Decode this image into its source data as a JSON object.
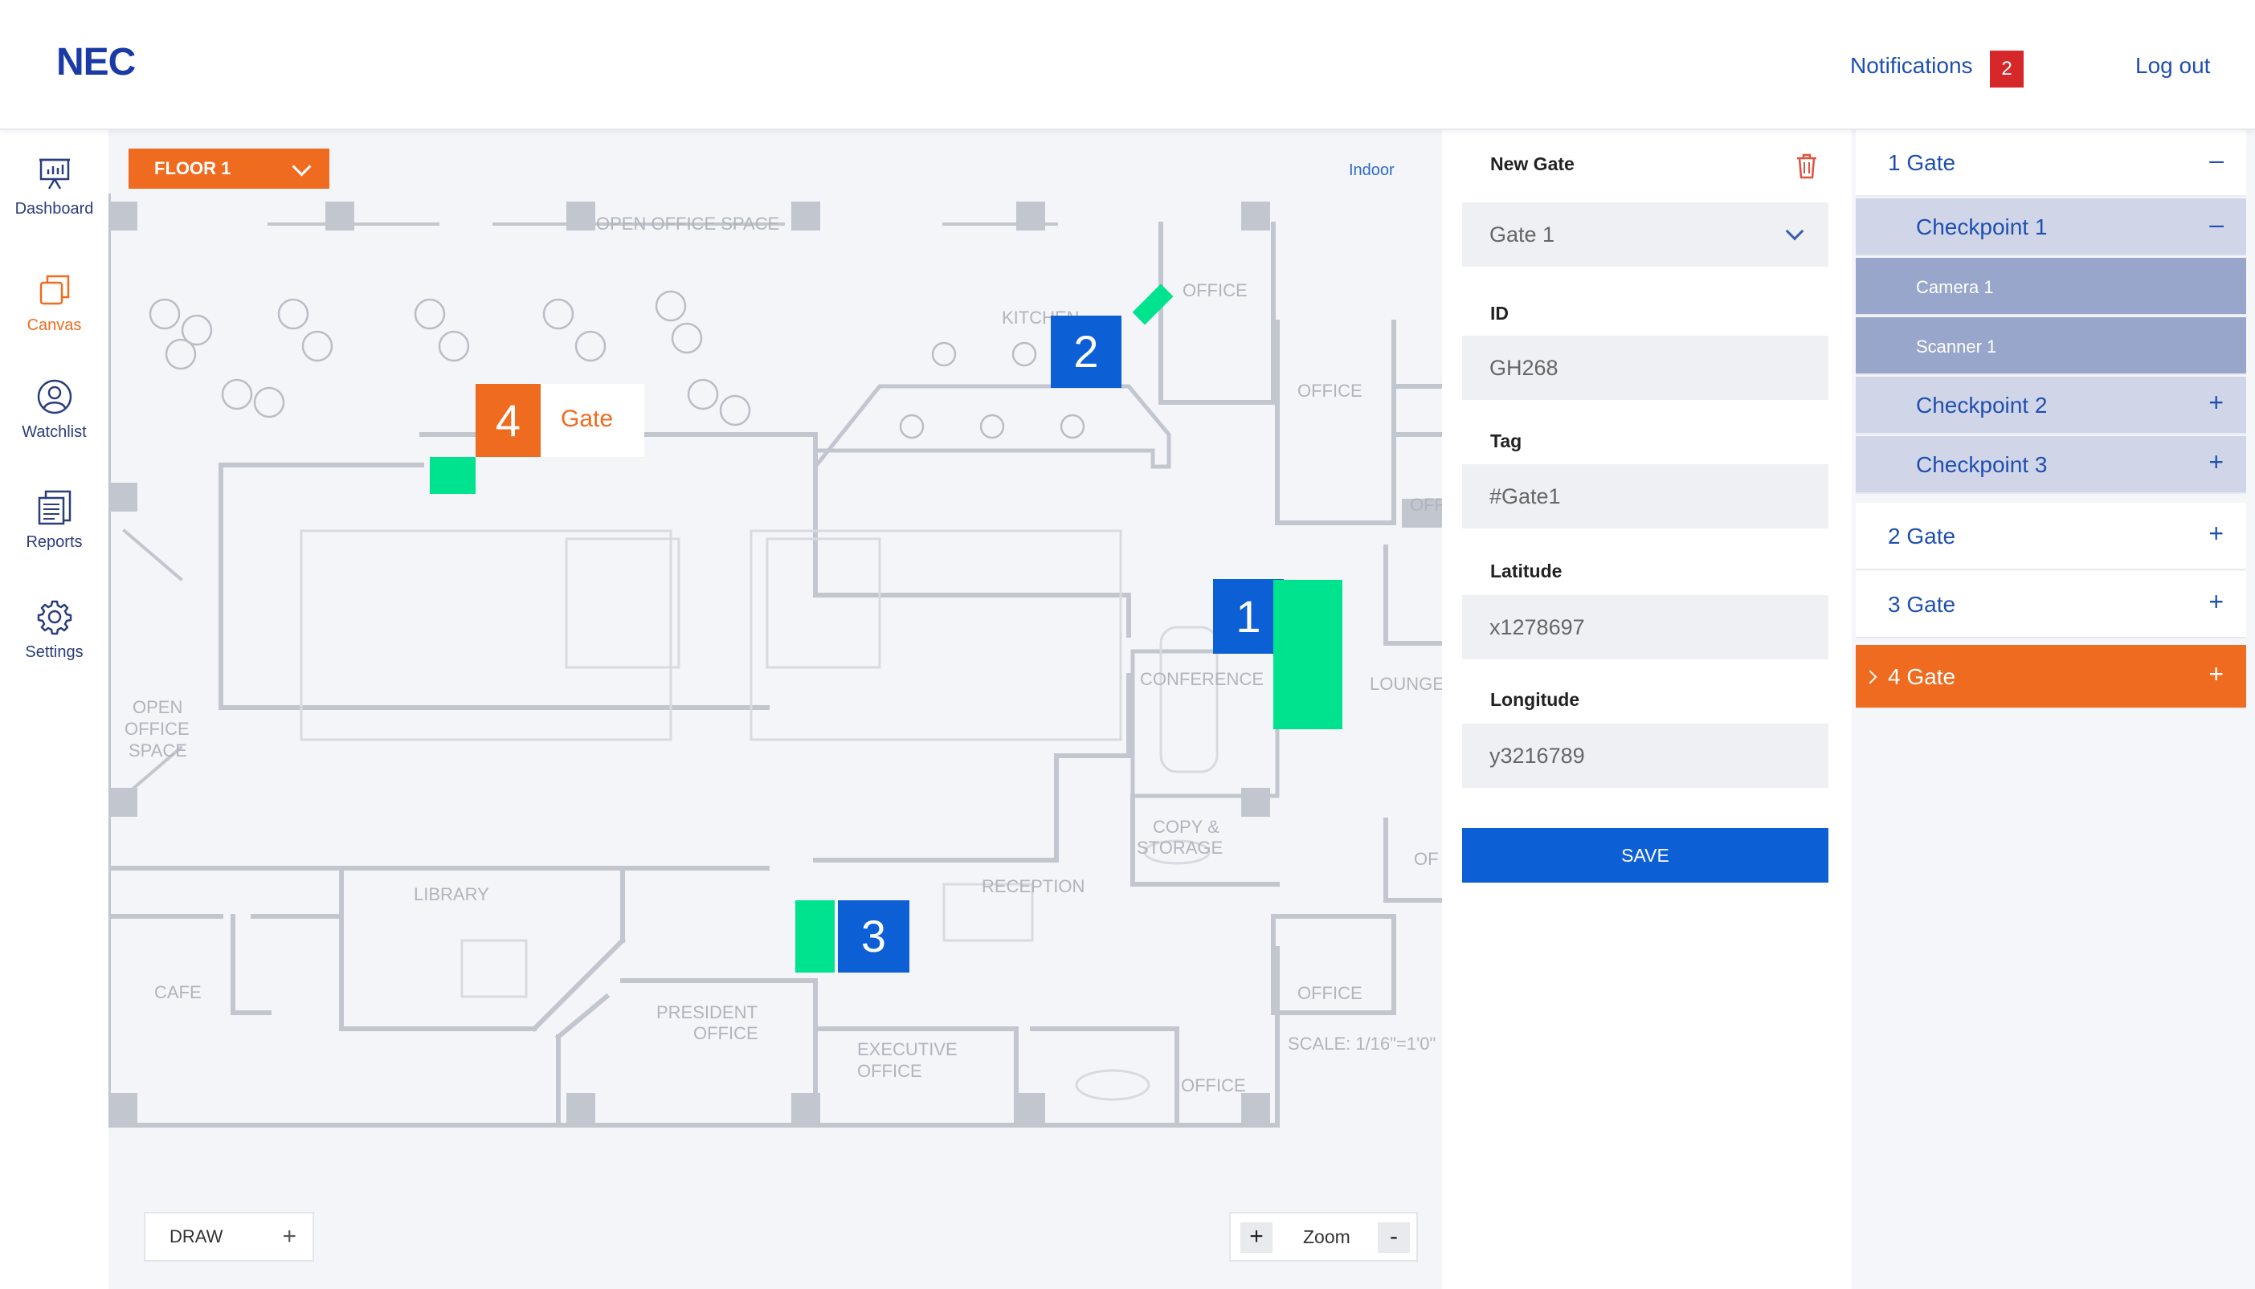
{
  "header": {
    "logo": "NEC",
    "notifications_label": "Notifications",
    "notifications_count": "2",
    "logout_label": "Log out"
  },
  "nav": {
    "items": [
      {
        "label": "Dashboard",
        "icon": "presentation-icon"
      },
      {
        "label": "Canvas",
        "icon": "canvas-icon",
        "active": true
      },
      {
        "label": "Watchlist",
        "icon": "user-icon"
      },
      {
        "label": "Reports",
        "icon": "reports-icon"
      },
      {
        "label": "Settings",
        "icon": "gear-icon"
      }
    ]
  },
  "map": {
    "floor_label": "FLOOR 1",
    "mode_label": "Indoor",
    "draw_label": "DRAW",
    "zoom_label": "Zoom",
    "zoom_in": "+",
    "zoom_out": "-",
    "rooms": {
      "open_office_space_top": "OPEN OFFICE SPACE",
      "kitchen": "KITCHEN",
      "office_a": "OFFICE",
      "office_b": "OFFICE",
      "office_c": "OFFI",
      "conference": "CONFERENCE",
      "lounge": "LOUNGE",
      "copy_storage_1": "COPY &",
      "copy_storage_2": "STORAGE",
      "open_office_left_1": "OPEN",
      "open_office_left_2": "OFFICE",
      "open_office_left_3": "SPACE",
      "library": "LIBRARY",
      "reception": "RECEPTION",
      "cafe": "CAFE",
      "president_office_1": "PRESIDENT",
      "president_office_2": "OFFICE",
      "executive_office_1": "EXECUTIVE",
      "executive_office_2": "OFFICE",
      "office_d": "OFFICE",
      "office_e": "OFFICE",
      "office_f": "OF",
      "scale": "SCALE: 1/16\"=1'0\""
    },
    "markers": [
      {
        "number": "1"
      },
      {
        "number": "2"
      },
      {
        "number": "3"
      },
      {
        "number": "4",
        "label": "Gate"
      }
    ],
    "colors": {
      "marker_blue": "#0d5fd6",
      "marker_orange": "#ef6b1f",
      "gate_green": "#00e38e"
    }
  },
  "form": {
    "title": "New Gate",
    "gate_select": "Gate 1",
    "id_label": "ID",
    "id_value": "GH268",
    "tag_label": "Tag",
    "tag_value": "#Gate1",
    "lat_label": "Latitude",
    "lat_value": "x1278697",
    "lon_label": "Longitude",
    "lon_value": "y3216789",
    "save_label": "SAVE"
  },
  "tree": {
    "gate1": "1 Gate",
    "cp1": "Checkpoint 1",
    "camera1": "Camera 1",
    "scanner1": "Scanner 1",
    "cp2": "Checkpoint 2",
    "cp3": "Checkpoint 3",
    "gate2": "2 Gate",
    "gate3": "3 Gate",
    "gate4": "4 Gate",
    "plus": "+",
    "minus": "–"
  }
}
